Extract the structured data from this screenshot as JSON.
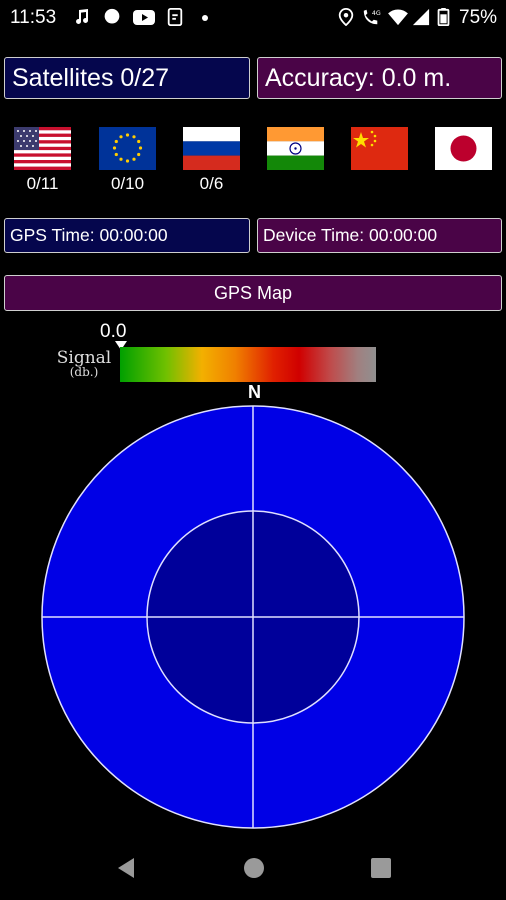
{
  "status_bar": {
    "time": "11:53",
    "battery_percent": "75%",
    "icons": [
      "music-note-icon",
      "circle-icon",
      "youtube-icon",
      "phone-clipboard-icon",
      "dot-icon",
      "location-icon",
      "wifi-call-icon",
      "wifi-icon",
      "signal-icon",
      "battery-icon"
    ]
  },
  "header": {
    "satellites": "Satellites 0/27",
    "accuracy": "Accuracy: 0.0 m."
  },
  "constellations": [
    {
      "name": "usa-flag-icon",
      "count": "0/11"
    },
    {
      "name": "eu-flag-icon",
      "count": "0/10"
    },
    {
      "name": "russia-flag-icon",
      "count": "0/6"
    },
    {
      "name": "india-flag-icon",
      "count": ""
    },
    {
      "name": "china-flag-icon",
      "count": ""
    },
    {
      "name": "japan-flag-icon",
      "count": ""
    }
  ],
  "times": {
    "gps_time": "GPS Time: 00:00:00",
    "device_time": "Device Time: 00:00:00"
  },
  "gps_map_button": "GPS Map",
  "signal": {
    "value": "0.0",
    "label": "Signal",
    "unit": "(db.)"
  },
  "compass": {
    "north": "N"
  },
  "colors": {
    "navy_box": "#05064d",
    "purple_box": "#4a0447",
    "radar_outer": "#0000e6",
    "radar_inner": "#00009a"
  },
  "nav_bar": {
    "icons": [
      "back-icon",
      "home-icon",
      "recents-icon"
    ]
  }
}
